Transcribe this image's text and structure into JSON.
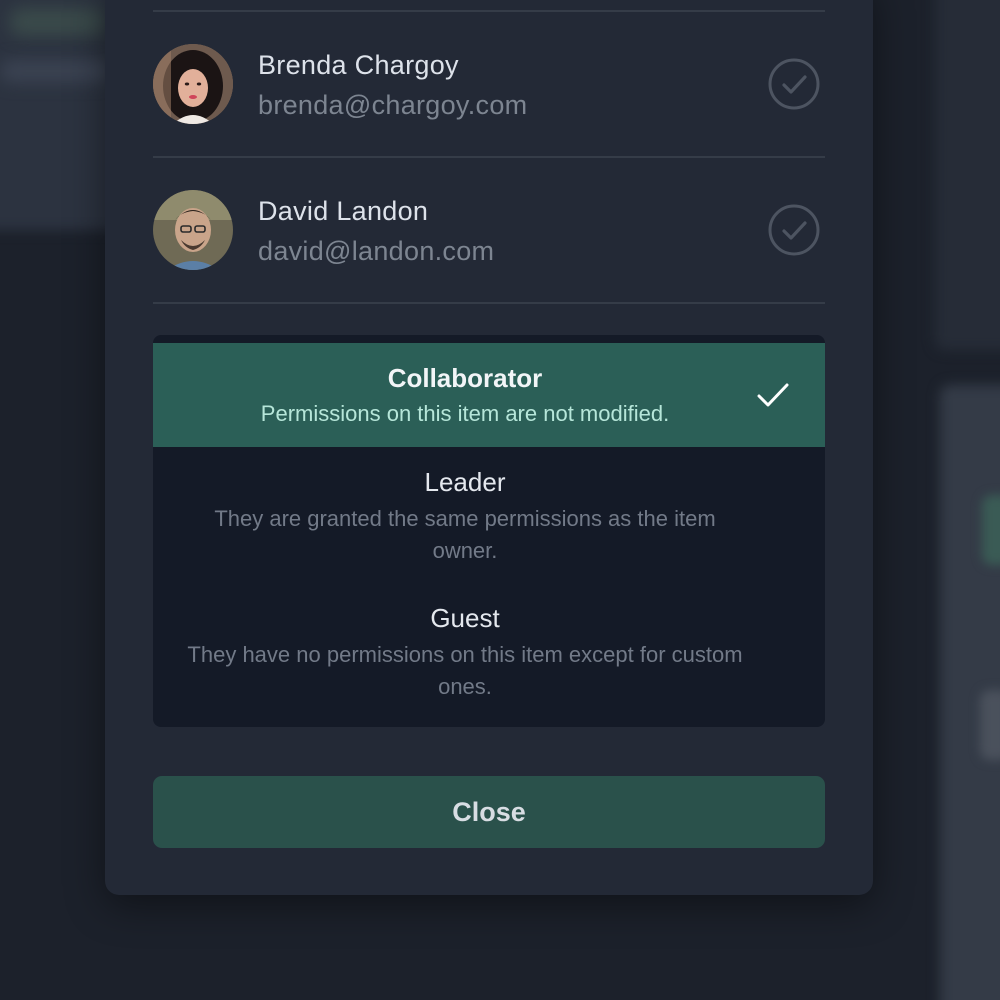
{
  "users": [
    {
      "name": "Brenda Chargoy",
      "email": "brenda@chargoy.com",
      "avatar_icon": "avatar-brenda",
      "status_icon": "check-circle-icon"
    },
    {
      "name": "David Landon",
      "email": "david@landon.com",
      "avatar_icon": "avatar-david",
      "status_icon": "check-circle-icon"
    }
  ],
  "role_menu": {
    "options": [
      {
        "label": "Collaborator",
        "description": "Permissions on this item are not modified.",
        "selected": true
      },
      {
        "label": "Leader",
        "description": "They are granted the same permissions as the item owner.",
        "selected": false
      },
      {
        "label": "Guest",
        "description": "They have no permissions on this item except for custom ones.",
        "selected": false
      }
    ]
  },
  "footer": {
    "close_label": "Close"
  },
  "colors": {
    "modal_bg": "#232936",
    "menu_bg": "#141a27",
    "selected_bg": "#2b5f57",
    "button_bg": "#2a514b"
  }
}
